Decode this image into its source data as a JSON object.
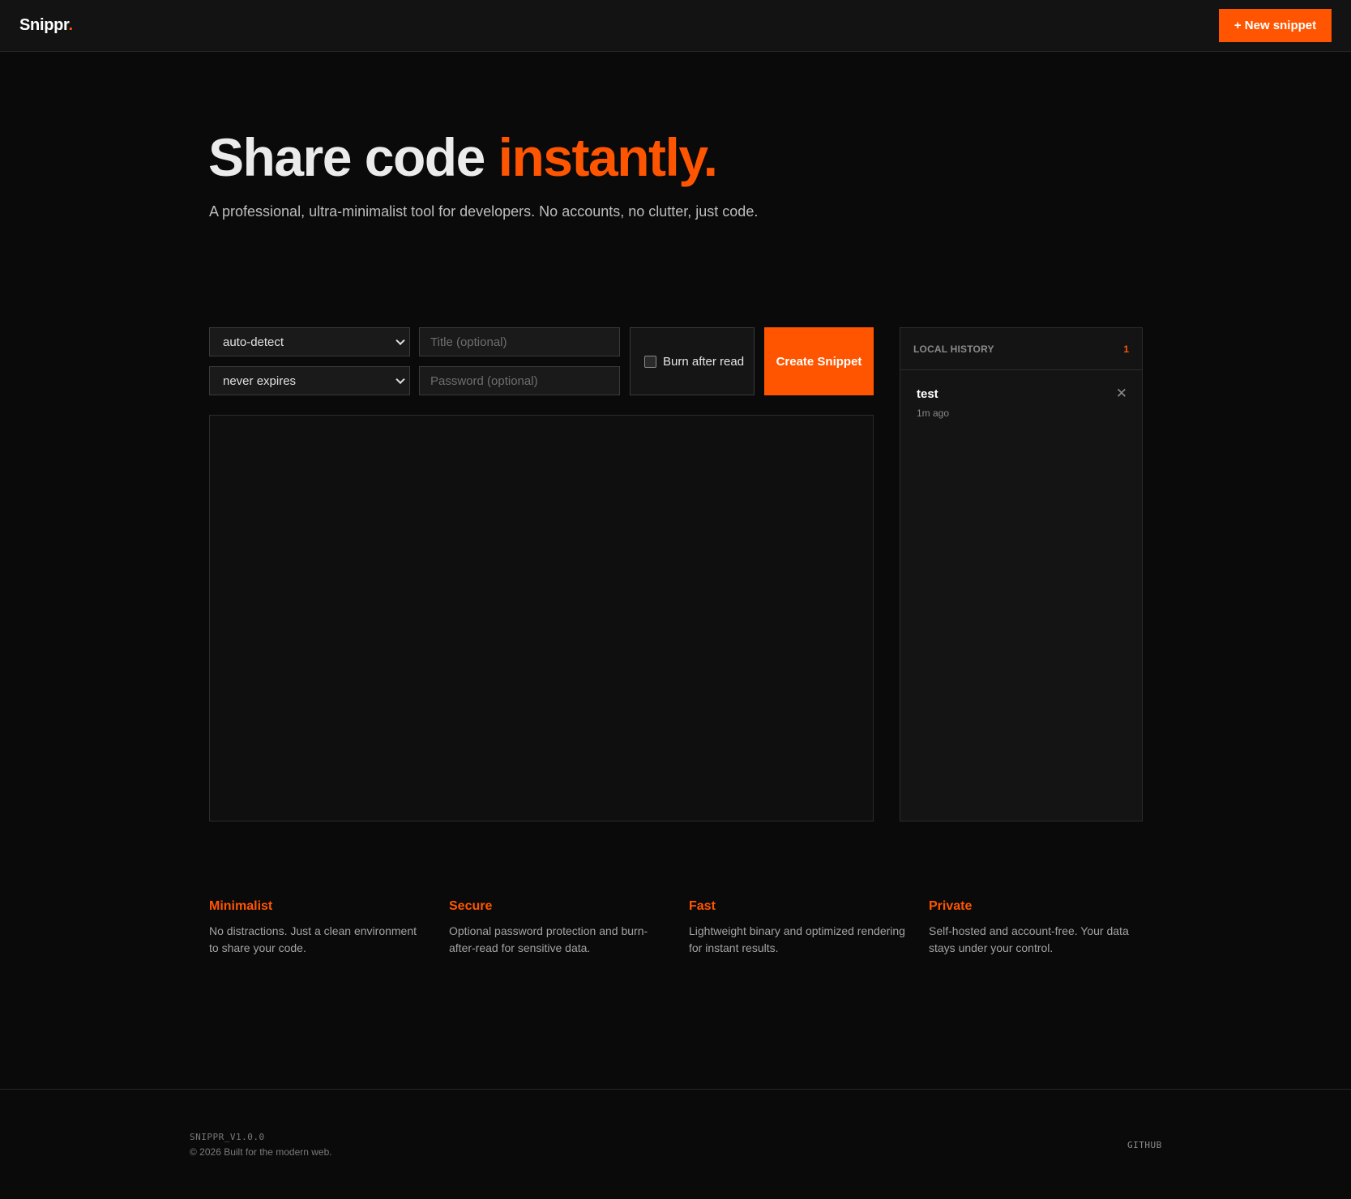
{
  "header": {
    "logo_text": "Snippr",
    "logo_dot": ".",
    "new_snippet_label": "+ New snippet"
  },
  "hero": {
    "title_main": "Share code ",
    "title_accent": "instantly.",
    "subtitle": "A professional, ultra-minimalist tool for developers. No accounts, no clutter, just code."
  },
  "form": {
    "language_value": "auto-detect",
    "expiry_value": "never expires",
    "title_placeholder": "Title (optional)",
    "password_placeholder": "Password (optional)",
    "burn_label": "Burn after read",
    "burn_checked": false,
    "create_label": "Create Snippet",
    "code_value": ""
  },
  "history": {
    "title": "LOCAL HISTORY",
    "count": "1",
    "items": [
      {
        "title": "test",
        "time": "1m ago",
        "close_icon": "close-icon"
      }
    ]
  },
  "features": [
    {
      "title": "Minimalist",
      "text": "No distractions. Just a clean environment to share your code."
    },
    {
      "title": "Secure",
      "text": "Optional password protection and burn-after-read for sensitive data."
    },
    {
      "title": "Fast",
      "text": "Lightweight binary and optimized rendering for instant results."
    },
    {
      "title": "Private",
      "text": "Self-hosted and account-free. Your data stays under your control."
    }
  ],
  "footer": {
    "version": "SNIPPR_V1.0.0",
    "copyright": "© 2026 Built for the modern web.",
    "github": "GITHUB"
  },
  "colors": {
    "accent": "#ff5500",
    "background": "#0a0a0a",
    "panel": "#141414",
    "border": "#2c2c2c"
  }
}
